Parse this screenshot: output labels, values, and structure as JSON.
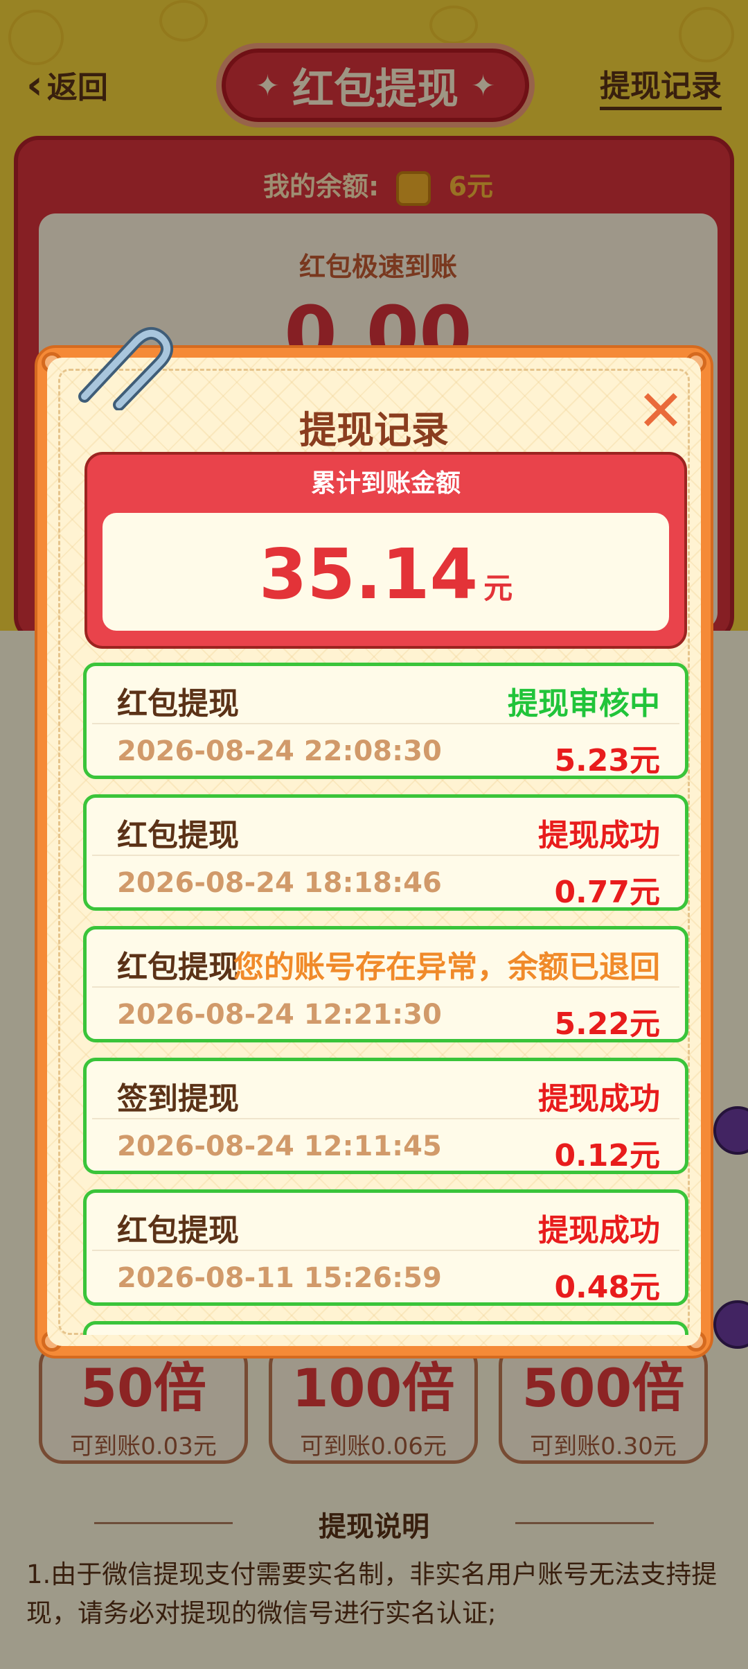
{
  "colors": {
    "accent_red": "#d8323a",
    "modal_orange": "#f58a37",
    "success_green": "#21c43a",
    "fail_orange": "#f08a2a",
    "amount_red": "#e81c1c"
  },
  "nav": {
    "back_label": "返回",
    "back_icon": "chevron-left-icon",
    "title": "红包提现",
    "records_link": "提现记录"
  },
  "balance": {
    "label": "我的余额:",
    "amount": "6元",
    "icon": "coin-icon"
  },
  "card": {
    "title": "红包极速到账",
    "amount": "0.00"
  },
  "modal": {
    "title": "提现记录",
    "close_icon": "close-icon",
    "clip_icon": "paperclip-icon",
    "total_label": "累计到账金额",
    "total_value": "35.14",
    "total_unit": "元",
    "records": [
      {
        "name": "红包提现",
        "status": "提现审核中",
        "status_color": "#21c43a",
        "time": "2026-08-24 22:08:30",
        "amount": "5.23元"
      },
      {
        "name": "红包提现",
        "status": "提现成功",
        "status_color": "#e81c1c",
        "time": "2026-08-24 18:18:46",
        "amount": "0.77元"
      },
      {
        "name": "红包提现",
        "status": "您的账号存在异常，余额已退回",
        "status_color": "#f08a2a",
        "time": "2026-08-24 12:21:30",
        "amount": "5.22元"
      },
      {
        "name": "签到提现",
        "status": "提现成功",
        "status_color": "#e81c1c",
        "time": "2026-08-24 12:11:45",
        "amount": "0.12元"
      },
      {
        "name": "红包提现",
        "status": "提现成功",
        "status_color": "#e81c1c",
        "time": "2026-08-11 15:26:59",
        "amount": "0.48元"
      }
    ]
  },
  "multipliers": [
    {
      "big": "50倍",
      "small": "可到账0.03元"
    },
    {
      "big": "100倍",
      "small": "可到账0.06元"
    },
    {
      "big": "500倍",
      "small": "可到账0.30元"
    }
  ],
  "explain": {
    "title": "提现说明",
    "text": "1.由于微信提现支付需要实名制，非实名用户账号无法支持提现，请务必对提现的微信号进行实名认证;"
  }
}
